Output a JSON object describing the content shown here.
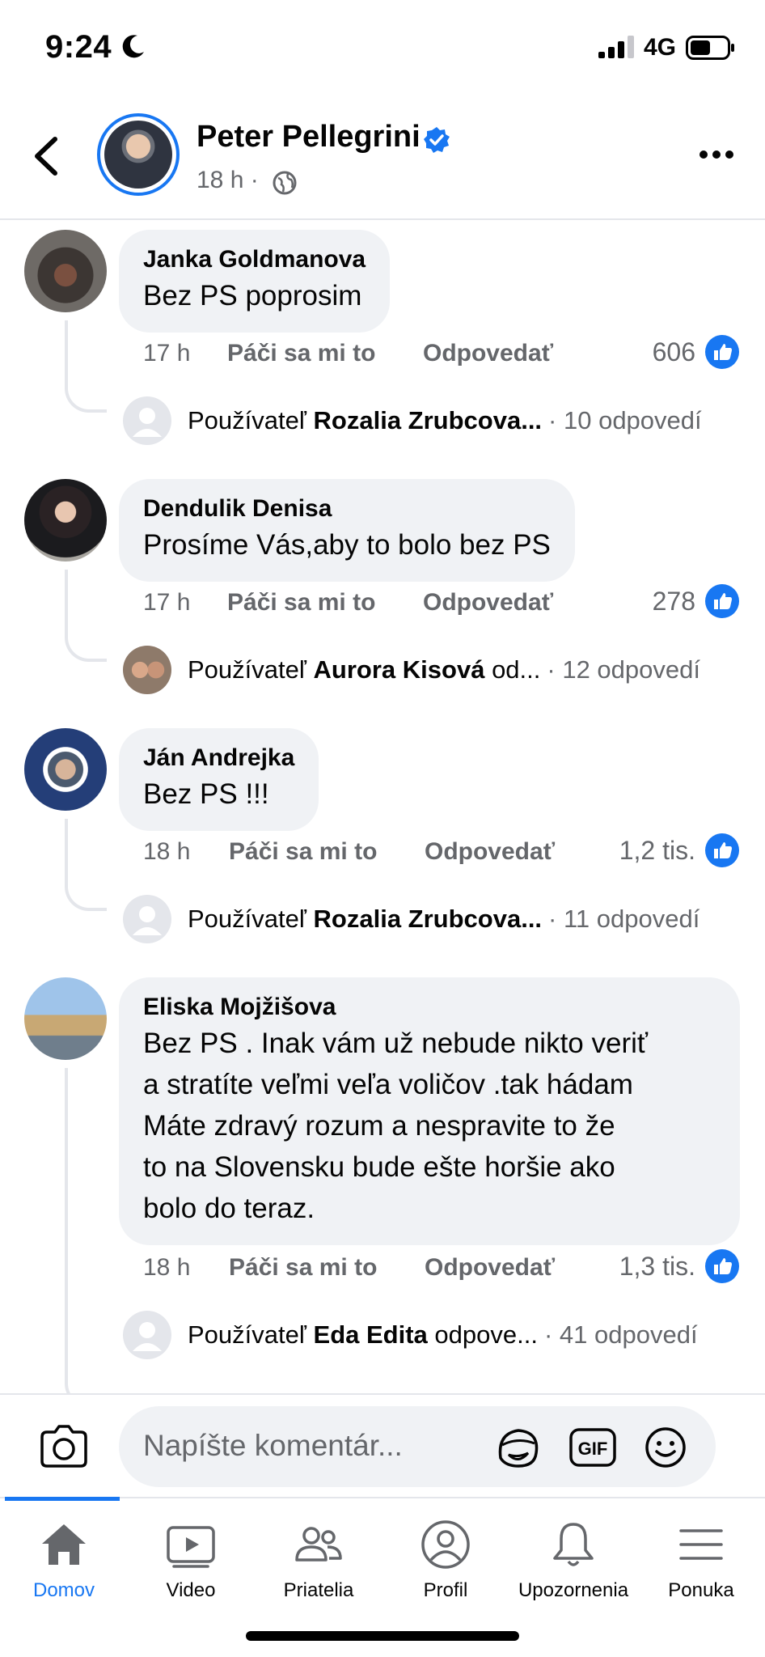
{
  "status_bar": {
    "time": "9:24",
    "network": "4G"
  },
  "header": {
    "author": "Peter Pellegrini",
    "age": "18 h ·"
  },
  "comments": [
    {
      "name": "Janka Goldmanova",
      "text": "Bez PS poprosim",
      "age": "17 h",
      "like_label": "Páči sa mi to",
      "reply_label": "Odpovedať",
      "likes": "606",
      "reply_prefix": "Používateľ",
      "reply_user": "Rozalia Zrubcova...",
      "reply_count": "· 10 odpovedí"
    },
    {
      "name": "Dendulik Denisa",
      "text": "Prosíme Vás,aby to bolo bez PS",
      "age": "17 h",
      "like_label": "Páči sa mi to",
      "reply_label": "Odpovedať",
      "likes": "278",
      "reply_prefix": "Používateľ",
      "reply_user": "Aurora Kisová",
      "reply_suffix": "od...",
      "reply_count": "· 12 odpovedí"
    },
    {
      "name": "Ján Andrejka",
      "text": "Bez PS !!!",
      "age": "18 h",
      "like_label": "Páči sa mi to",
      "reply_label": "Odpovedať",
      "likes": "1,2 tis.",
      "reply_prefix": "Používateľ",
      "reply_user": "Rozalia Zrubcova...",
      "reply_count": "· 11 odpovedí"
    },
    {
      "name": "Eliska Mojžišova",
      "text": "Bez  PS . Inak vám  už  nebude nikto veriť\na stratíte veľmi veľa voličov .tak hádam\nMáte zdravý  rozum  a nespravite to  že\nto na Slovensku bude ešte horšie ako\nbolo do teraz.",
      "age": "18 h",
      "like_label": "Páči sa mi to",
      "reply_label": "Odpovedať",
      "likes": "1,3 tis.",
      "reply_prefix": "Používateľ",
      "reply_user": "Eda Edita",
      "reply_suffix": "odpove...",
      "reply_count": "· 41 odpovedí"
    }
  ],
  "composer": {
    "placeholder": "Napíšte komentár..."
  },
  "tabs": [
    {
      "label": "Domov",
      "icon": "home-icon",
      "active": true
    },
    {
      "label": "Video",
      "icon": "video-icon"
    },
    {
      "label": "Priatelia",
      "icon": "friends-icon"
    },
    {
      "label": "Profil",
      "icon": "profile-icon"
    },
    {
      "label": "Upozornenia",
      "icon": "bell-icon"
    },
    {
      "label": "Ponuka",
      "icon": "menu-icon"
    }
  ],
  "colors": {
    "accent": "#1877f2",
    "bubble": "#f0f2f5",
    "secondary_text": "#65676b"
  }
}
